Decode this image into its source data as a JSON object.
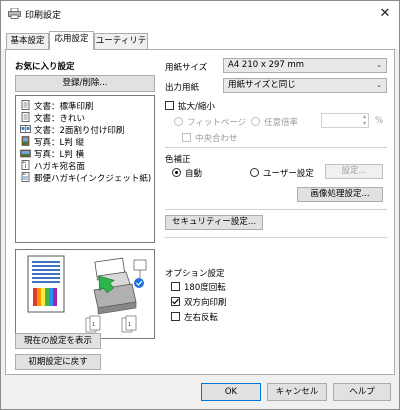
{
  "window": {
    "title": "印刷設定",
    "close_glyph": "✕"
  },
  "tabs": [
    {
      "label": "基本設定",
      "active": false
    },
    {
      "label": "応用設定",
      "active": true
    },
    {
      "label": "ユーティリティー",
      "active": false
    }
  ],
  "favorites": {
    "heading": "お気に入り設定",
    "register_button": "登録/削除...",
    "items": [
      {
        "label": "文書：標準印刷",
        "icon": "document-icon"
      },
      {
        "label": "文書：きれい",
        "icon": "document-icon"
      },
      {
        "label": "文書：2面割り付け印刷",
        "icon": "two-up-document-icon"
      },
      {
        "label": "写真：L判 縦",
        "icon": "photo-portrait-icon"
      },
      {
        "label": "写真：L判 横",
        "icon": "photo-landscape-icon"
      },
      {
        "label": "ハガキ宛名面",
        "icon": "postcard-address-icon"
      },
      {
        "label": "郵便ハガキ(インクジェット紙)",
        "icon": "postcard-inkjet-icon"
      }
    ],
    "show_current_button": "現在の設定を表示",
    "reset_button": "初期設定に戻す"
  },
  "paper": {
    "size_label": "用紙サイズ",
    "size_value": "A4 210 x 297 mm",
    "output_label": "出力用紙",
    "output_value": "用紙サイズと同じ",
    "scale_label": "拡大/縮小",
    "fit_page_label": "フィットページ",
    "custom_ratio_label": "任意倍率",
    "percent_unit": "%",
    "center_label": "中央合わせ"
  },
  "color": {
    "heading": "色補正",
    "auto_label": "自動",
    "user_label": "ユーザー設定",
    "settings_button": "設定...",
    "image_processing_button": "画像処理設定..."
  },
  "security": {
    "button": "セキュリティー設定..."
  },
  "options": {
    "heading": "オプション設定",
    "rotate180_label": "180度回転",
    "rotate180_checked": false,
    "bidirectional_label": "双方向印刷",
    "bidirectional_checked": true,
    "mirror_label": "左右反転",
    "mirror_checked": false
  },
  "footer": {
    "ok": "OK",
    "cancel": "キャンセル",
    "help": "ヘルプ"
  },
  "colors": {
    "accent": "#0078d7",
    "arrow": "#2db44a"
  }
}
